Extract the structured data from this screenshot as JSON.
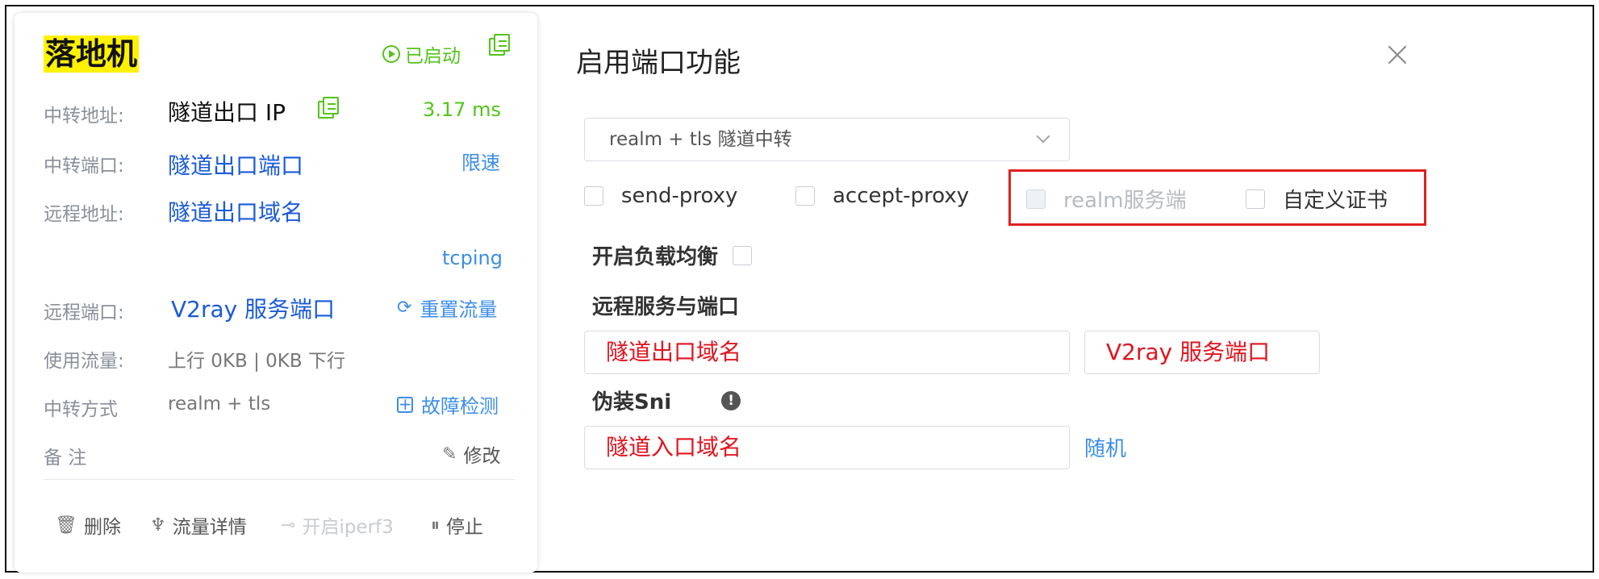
{
  "card": {
    "title": "落地机",
    "status": "已启动",
    "rows": {
      "relay_addr_label": "中转地址:",
      "relay_addr_value": "隧道出口 IP",
      "latency": "3.17 ms",
      "relay_port_label": "中转端口:",
      "relay_port_value": "隧道出口端口",
      "rate_limit": "限速",
      "remote_addr_label": "远程地址:",
      "remote_addr_value": "隧道出口域名",
      "tcping": "tcping",
      "remote_port_label": "远程端口:",
      "remote_port_value": "V2ray 服务端口",
      "reset_traffic": "重置流量",
      "traffic_label": "使用流量:",
      "traffic_value": "上行 0KB | 0KB 下行",
      "relay_mode_label": "中转方式",
      "relay_mode_value": "realm + tls",
      "fault_detect": "故障检测",
      "note_label": "备 注",
      "edit": "修改"
    },
    "actions": {
      "delete": "删除",
      "traffic_detail": "流量详情",
      "iperf": "开启iperf3",
      "stop": "停止"
    }
  },
  "dialog": {
    "title": "启用端口功能",
    "mode_select": "realm + tls 隧道中转",
    "checkboxes": {
      "send_proxy": "send-proxy",
      "accept_proxy": "accept-proxy",
      "realm_server": "realm服务端",
      "custom_cert": "自定义证书"
    },
    "load_balance_label": "开启负载均衡",
    "remote_label": "远程服务与端口",
    "remote_host_value": "隧道出口域名",
    "remote_port_value": "V2ray 服务端口",
    "sni_label": "伪装Sni",
    "sni_value": "隧道入口域名",
    "random": "随机"
  },
  "colors": {
    "accent_blue": "#1a5bd8",
    "link_blue": "#3b8ee8",
    "status_green": "#52c41a",
    "highlight_red": "#e02020",
    "title_highlight": "#fff200"
  }
}
